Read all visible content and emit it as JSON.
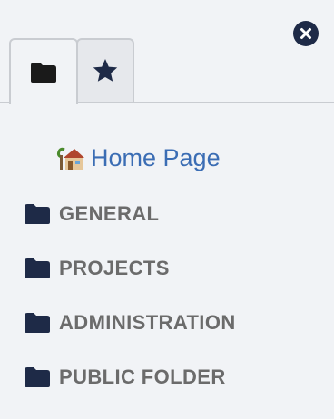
{
  "icons": {
    "close": "close-circle-icon",
    "tab_folders": "folder-icon",
    "tab_favorites": "star-icon",
    "home": "house-icon",
    "folder": "folder-icon"
  },
  "colors": {
    "background": "#f1f3f6",
    "accent_dark": "#1e2a47",
    "link": "#3b6db4",
    "folder_label": "#6b6b6b"
  },
  "home_link": {
    "label": "Home Page"
  },
  "folders": [
    {
      "label": "GENERAL"
    },
    {
      "label": "PROJECTS"
    },
    {
      "label": "ADMINISTRATION"
    },
    {
      "label": "PUBLIC FOLDER"
    }
  ]
}
